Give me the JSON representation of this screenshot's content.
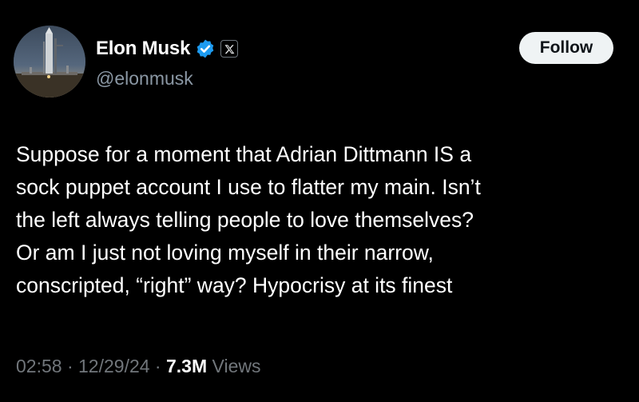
{
  "author": {
    "display_name": "Elon Musk",
    "handle": "@elonmusk",
    "verified": true,
    "verified_color": "#1d9bf0",
    "affiliation_icon": "x-logo-icon"
  },
  "actions": {
    "follow_label": "Follow"
  },
  "tweet": {
    "lines": [
      "Suppose for a moment that Adrian Dittmann IS a",
      "sock puppet account I use to flatter my main. Isn’t",
      "the left always telling people to love themselves?",
      "Or am I just not loving myself in their narrow,",
      "conscripted, “right” way? Hypocrisy at its finest"
    ]
  },
  "meta": {
    "time": "02:58",
    "separator": " · ",
    "date": "12/29/24",
    "views_count": "7.3M",
    "views_label": "Views"
  }
}
